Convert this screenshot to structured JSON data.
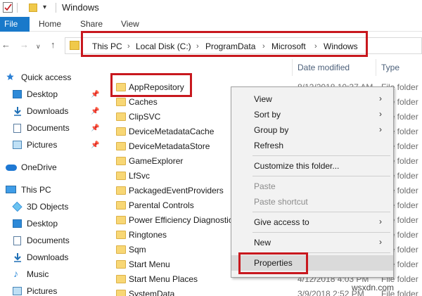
{
  "window": {
    "title": "Windows"
  },
  "ribbon": {
    "file": "File",
    "tabs": [
      "Home",
      "Share",
      "View"
    ]
  },
  "address": {
    "crumbs": [
      "This PC",
      "Local Disk (C:)",
      "ProgramData",
      "Microsoft",
      "Windows"
    ]
  },
  "columns": {
    "date": "Date modified",
    "type": "Type"
  },
  "nav": {
    "quick_access": "Quick access",
    "quick_items": [
      "Desktop",
      "Downloads",
      "Documents",
      "Pictures"
    ],
    "onedrive": "OneDrive",
    "this_pc": "This PC",
    "pc_items": [
      "3D Objects",
      "Desktop",
      "Documents",
      "Downloads",
      "Music",
      "Pictures"
    ]
  },
  "files": [
    {
      "name": "AppRepository",
      "date": "8/12/2018 10:37 AM",
      "type": "File folder"
    },
    {
      "name": "Caches",
      "date": "",
      "type": "File folder"
    },
    {
      "name": "ClipSVC",
      "date": "",
      "type": "File folder"
    },
    {
      "name": "DeviceMetadataCache",
      "date": "",
      "type": "File folder"
    },
    {
      "name": "DeviceMetadataStore",
      "date": "",
      "type": "File folder"
    },
    {
      "name": "GameExplorer",
      "date": "",
      "type": "File folder"
    },
    {
      "name": "LfSvc",
      "date": "",
      "type": "File folder"
    },
    {
      "name": "PackagedEventProviders",
      "date": "",
      "type": "File folder"
    },
    {
      "name": "Parental Controls",
      "date": "",
      "type": "File folder"
    },
    {
      "name": "Power Efficiency Diagnostics",
      "date": "",
      "type": "File folder"
    },
    {
      "name": "Ringtones",
      "date": "",
      "type": "File folder"
    },
    {
      "name": "Sqm",
      "date": "",
      "type": "File folder"
    },
    {
      "name": "Start Menu",
      "date": "",
      "type": "File folder"
    },
    {
      "name": "Start Menu Places",
      "date": "4/12/2018 4:03 PM",
      "type": "File folder"
    },
    {
      "name": "SystemData",
      "date": "3/9/2018 2:52 PM",
      "type": "File folder"
    }
  ],
  "context_menu": {
    "view": "View",
    "sort_by": "Sort by",
    "group_by": "Group by",
    "refresh": "Refresh",
    "customize": "Customize this folder...",
    "paste": "Paste",
    "paste_shortcut": "Paste shortcut",
    "give_access": "Give access to",
    "new": "New",
    "properties": "Properties"
  },
  "watermark": "wsxdn.com",
  "colors": {
    "accent": "#1979ca",
    "highlight_border": "#c8181e",
    "folder": "#f8d775",
    "menu_bg": "#f2f2f2"
  }
}
